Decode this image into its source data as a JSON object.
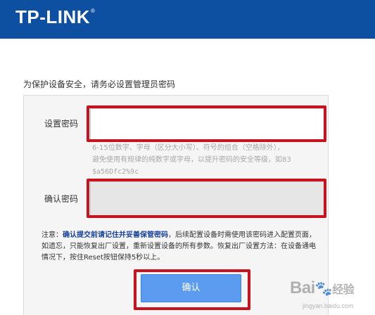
{
  "header": {
    "logo": "TP-LINK",
    "logo_mark": "®",
    "bg_color": "#0d4fa0"
  },
  "notice": "为保护设备安全，请务必设置管理员密码",
  "form": {
    "password_label": "设置密码",
    "password_value": "",
    "hint_line1": "6-15位数字、字母（区分大小写）、符号的组合（空格除外），",
    "hint_line2": "避免使用有规律的纯数字或字母，以提升密码的安全等级，如83",
    "hint_example": "$a56Dfc2%9c",
    "confirm_label": "确认密码",
    "confirm_value": ""
  },
  "note": {
    "prefix": "注意：",
    "emphasis": "确认提交前请记住并妥善保管密码",
    "rest": "，后续配置设备时需使用该密码进入配置页面，如遗忘，只能恢复出厂设置，重新设置设备的所有参数。恢复出厂设置方法：在设备通电情况下，按住Reset按钮保持5秒以上。"
  },
  "confirm_button": "确认",
  "highlight_color": "#c8121d",
  "button_color": "#5b9cf0",
  "watermark": {
    "main": "Bai",
    "paw": "🐾",
    "cn": "经验",
    "sub": "jingyan.baidu.com"
  }
}
